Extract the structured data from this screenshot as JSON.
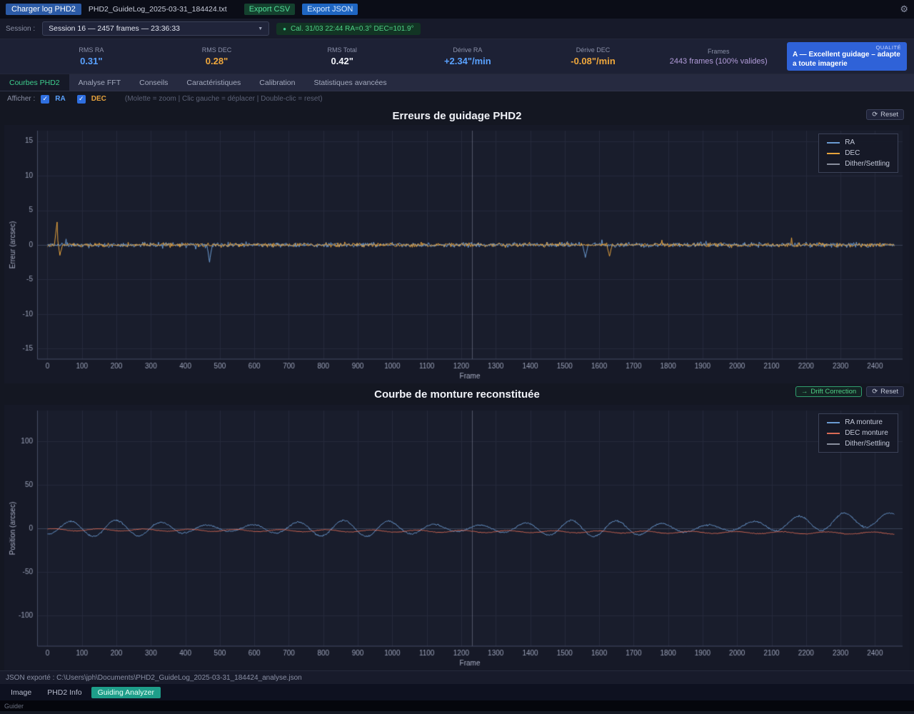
{
  "theme": {
    "accent_blue": "#5aa2ff",
    "accent_orange": "#e6a23c",
    "accent_green": "#3ecf8e",
    "accent_red": "#d96a55",
    "accent_purple": "#b39ddb",
    "quality_blue": "#2f62d8"
  },
  "icons": {
    "gear": "⚙",
    "chevron_down": "▼",
    "cal_dot": "●",
    "check": "✓",
    "reset": "⟳",
    "arrow_right": "→"
  },
  "toolbar": {
    "load_button": "Charger log PHD2",
    "filename": "PHD2_GuideLog_2025-03-31_184424.txt",
    "export_csv": "Export CSV",
    "export_json": "Export JSON"
  },
  "session": {
    "label": "Session :",
    "selected": "Session 16 — 2457 frames — 23:36:33",
    "calibration": "Cal. 31/03 22:44   RA=0.3°   DEC=101.9°"
  },
  "stats": [
    {
      "label": "RMS RA",
      "value": "0.31\""
    },
    {
      "label": "RMS DEC",
      "value": "0.28\""
    },
    {
      "label": "RMS Total",
      "value": "0.42\""
    },
    {
      "label": "Dérive RA",
      "value": "+2.34\"/min"
    },
    {
      "label": "Dérive DEC",
      "value": "-0.08\"/min"
    },
    {
      "label": "Frames",
      "value": "2443 frames (100% valides)"
    }
  ],
  "quality": {
    "label": "QUALITÉ",
    "value": "A — Excellent guidage – adapte a toute imagerie"
  },
  "tabs": [
    {
      "label": "Courbes PHD2"
    },
    {
      "label": "Analyse FFT"
    },
    {
      "label": "Conseils"
    },
    {
      "label": "Caractéristiques"
    },
    {
      "label": "Calibration"
    },
    {
      "label": "Statistiques avancées"
    }
  ],
  "filter": {
    "label": "Afficher :",
    "ra": "RA",
    "dec": "DEC",
    "hint": "(Molette = zoom  |  Clic gauche = déplacer  |  Double-clic = reset)"
  },
  "chart_buttons": {
    "reset": "Reset",
    "drift_correction": "Drift Correction"
  },
  "status": {
    "json_export": "JSON exporté : C:\\Users\\jph\\Documents\\PHD2_GuideLog_2025-03-31_184424_analyse.json"
  },
  "bottom_tabs": [
    {
      "label": "Image"
    },
    {
      "label": "PHD2 Info"
    },
    {
      "label": "Guiding Analyzer"
    }
  ],
  "window_label": "Guider",
  "chart_data": [
    {
      "id": "guide-errors",
      "type": "line",
      "title": "Erreurs de guidage PHD2",
      "xlabel": "Frame",
      "ylabel": "Erreur (arcsec)",
      "xlim": [
        -30,
        2480
      ],
      "ylim": [
        -16.5,
        16.5
      ],
      "yticks": [
        -15,
        -10,
        -5,
        0,
        5,
        10,
        15
      ],
      "xticks_step": 100,
      "xticks_max": 2400,
      "n_frames": 2457,
      "grid": true,
      "legend_position": "top-right",
      "legend": [
        {
          "label": "RA",
          "color": "#6b9bd2"
        },
        {
          "label": "DEC",
          "color": "#e6a23c"
        },
        {
          "label": "Dither/Settling",
          "color": "#8a8f9e"
        }
      ],
      "dither_x": [
        1232
      ],
      "series": [
        {
          "name": "RA",
          "color": "#6b9bd2",
          "gen": {
            "kind": "noise",
            "seed": 11,
            "sigma": 0.42,
            "spike_prob": 0.006,
            "spike_gain": 2.6,
            "spikes": [
              {
                "x": 470,
                "v": -2.4
              },
              {
                "x": 1560,
                "v": -1.8
              }
            ]
          }
        },
        {
          "name": "DEC",
          "color": "#e6a23c",
          "gen": {
            "kind": "noise",
            "seed": 29,
            "sigma": 0.36,
            "spike_prob": 0.005,
            "spike_gain": 2.4,
            "spikes": [
              {
                "x": 28,
                "v": 3.3
              },
              {
                "x": 36,
                "v": -1.5
              },
              {
                "x": 1630,
                "v": -1.6
              }
            ]
          }
        }
      ]
    },
    {
      "id": "mount-curve",
      "type": "line",
      "title": "Courbe de monture reconstituée",
      "xlabel": "Frame",
      "ylabel": "Position (arcsec)",
      "xlim": [
        -30,
        2480
      ],
      "ylim": [
        -135,
        135
      ],
      "yticks": [
        -100,
        -50,
        0,
        50,
        100
      ],
      "xticks_step": 100,
      "xticks_max": 2400,
      "n_frames": 2457,
      "grid": true,
      "legend_position": "top-right",
      "legend": [
        {
          "label": "RA monture",
          "color": "#6b9bd2"
        },
        {
          "label": "DEC monture",
          "color": "#d96a55"
        },
        {
          "label": "Dither/Settling",
          "color": "#8a8f9e"
        }
      ],
      "dither_x": [
        1232
      ],
      "series": [
        {
          "name": "RA monture",
          "color": "#6b9bd2",
          "gen": {
            "kind": "wave",
            "seed": 5,
            "period": 132,
            "amplitude": 6.5,
            "amp_mod": 0.45,
            "amp_mod_period": 700,
            "phase": -1.6,
            "noise": 1.1,
            "trend_after": 1900,
            "trend_value": 11
          }
        },
        {
          "name": "DEC monture",
          "color": "#d96a55",
          "gen": {
            "kind": "drift",
            "seed": 17,
            "start": -1.5,
            "end": -5.5,
            "wobble_amp": 1.2,
            "wobble_period": 132,
            "noise": 0.8
          }
        }
      ]
    }
  ]
}
